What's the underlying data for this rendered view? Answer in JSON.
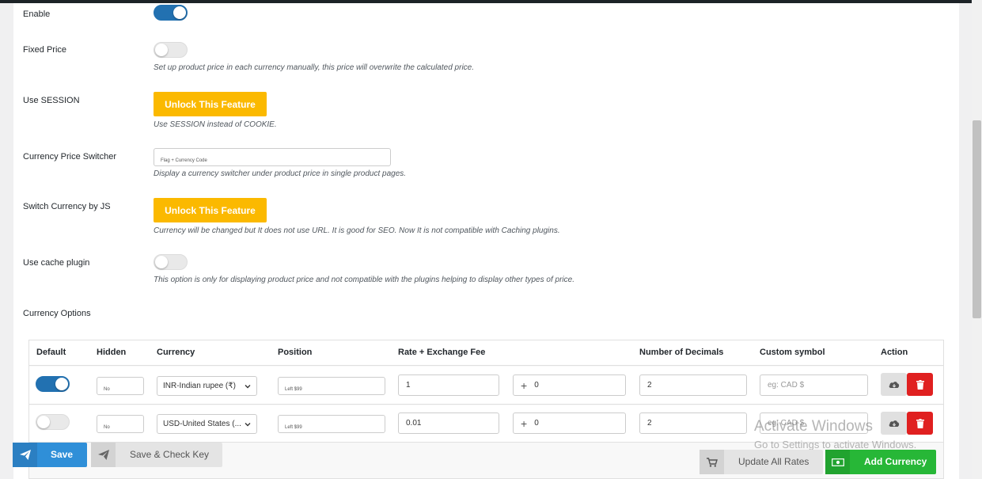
{
  "settings": {
    "enable_label": "Enable",
    "fixed_price_label": "Fixed Price",
    "fixed_price_desc": "Set up product price in each currency manually, this price will overwrite the calculated price.",
    "use_session_label": "Use SESSION",
    "unlock_label": "Unlock This Feature",
    "use_session_desc": "Use SESSION instead of COOKIE.",
    "switcher_label": "Currency Price Switcher",
    "switcher_value": "Flag + Currency Code",
    "switcher_desc": "Display a currency switcher under product price in single product pages.",
    "switch_js_label": "Switch Currency by JS",
    "switch_js_desc": "Currency will be changed but It does not use URL. It is good for SEO. Now It is not compatible with Caching plugins.",
    "cache_label": "Use cache plugin",
    "cache_desc": "This option is only for displaying product price and not compatible with the plugins helping to display other types of price.",
    "currency_options_label": "Currency Options"
  },
  "table": {
    "headers": {
      "default": "Default",
      "hidden": "Hidden",
      "currency": "Currency",
      "position": "Position",
      "rate": "Rate + Exchange Fee",
      "decimals": "Number of Decimals",
      "symbol": "Custom symbol",
      "action": "Action"
    },
    "rows": [
      {
        "hidden": "No",
        "currency": "INR-Indian rupee (₹)",
        "position": "Left $99",
        "rate": "1",
        "fee": "0",
        "decimals": "2",
        "symbol_placeholder": "eg: CAD $"
      },
      {
        "hidden": "No",
        "currency": "USD-United States (...",
        "position": "Left $99",
        "rate": "0.01",
        "fee": "0",
        "decimals": "2",
        "symbol_placeholder": "eg: CAD $"
      }
    ]
  },
  "buttons": {
    "save": "Save",
    "save_check": "Save & Check Key",
    "update_rates": "Update All Rates",
    "add_currency": "Add Currency"
  },
  "watermark": {
    "title": "Activate Windows",
    "subtitle": "Go to Settings to activate Windows."
  },
  "colors": {
    "toggle_on": "#2271b1",
    "unlock": "#fbb900",
    "save": "#2f8fd8",
    "add": "#27b737",
    "delete": "#e02020"
  }
}
